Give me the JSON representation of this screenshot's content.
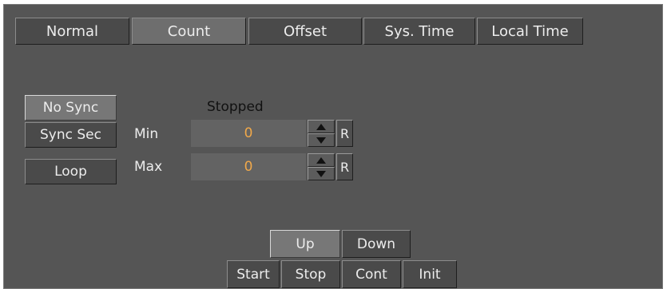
{
  "tabs": [
    {
      "label": "Normal"
    },
    {
      "label": "Count"
    },
    {
      "label": "Offset"
    },
    {
      "label": "Sys. Time"
    },
    {
      "label": "Local Time"
    }
  ],
  "sync": {
    "no_sync": "No Sync",
    "sync_sec": "Sync Sec",
    "loop": "Loop"
  },
  "status": "Stopped",
  "min": {
    "label": "Min",
    "value": "0",
    "reset": "R"
  },
  "max": {
    "label": "Max",
    "value": "0",
    "reset": "R"
  },
  "direction": {
    "up": "Up",
    "down": "Down"
  },
  "controls": {
    "start": "Start",
    "stop": "Stop",
    "cont": "Cont",
    "init": "Init"
  },
  "colors": {
    "panel": "#555555",
    "value": "#f0a84a"
  }
}
